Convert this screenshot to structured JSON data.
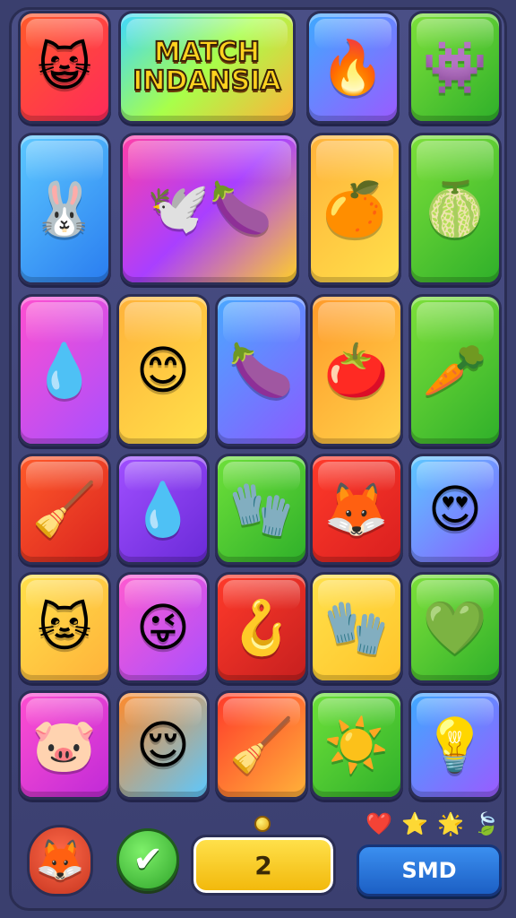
{
  "title": "MATCH\nINDANSIA",
  "tiles": [
    {
      "name": "blue-cat-coin-tile",
      "glyph": "😺",
      "bg": "linear-gradient(135deg,#ff5a2a,#ff2a5a)"
    },
    {
      "name": "fire-face-tile",
      "glyph": "🔥",
      "bg": "linear-gradient(135deg,#3fa9ff,#9a5bff)"
    },
    {
      "name": "green-blob-tile",
      "glyph": "👾",
      "bg": "linear-gradient(135deg,#7de03a,#2fb02a)"
    },
    {
      "name": "bunny-tile",
      "glyph": "🐰",
      "bg": "linear-gradient(135deg,#5cc8ff,#2a7df0)"
    },
    {
      "name": "dove-eggplant-tile",
      "glyph": "🕊️🍆",
      "bg": "linear-gradient(135deg,#ff3fa8,#a93fff,#ffcf2a)"
    },
    {
      "name": "orange-ball-tile",
      "glyph": "🍊",
      "bg": "linear-gradient(135deg,#ffb23a,#ffe04a)"
    },
    {
      "name": "green-drop-tile",
      "glyph": "🍈",
      "bg": "linear-gradient(135deg,#7de03a,#2fb02a)"
    },
    {
      "name": "blue-drop-tile",
      "glyph": "💧",
      "bg": "linear-gradient(135deg,#ff4fd0,#a84fff)"
    },
    {
      "name": "yellow-blob-tile",
      "glyph": "😊",
      "bg": "linear-gradient(135deg,#ffb23a,#ffe04a)"
    },
    {
      "name": "eggplant-tile",
      "glyph": "🍆",
      "bg": "linear-gradient(135deg,#4aa8ff,#8a5bff)"
    },
    {
      "name": "red-blob-tile",
      "glyph": "🍅",
      "bg": "linear-gradient(135deg,#ff9a2a,#ffd24a)"
    },
    {
      "name": "carrot-tile",
      "glyph": "🥕",
      "bg": "linear-gradient(135deg,#7de03a,#2fb02a)"
    },
    {
      "name": "broom-tile",
      "glyph": "🧹",
      "bg": "linear-gradient(135deg,#ff5a2a,#d9231f)"
    },
    {
      "name": "blue-drop-coin-tile",
      "glyph": "💧",
      "bg": "linear-gradient(135deg,#a04fff,#6a2ad8)"
    },
    {
      "name": "red-glove-tile",
      "glyph": "🧤",
      "bg": "linear-gradient(135deg,#6ee03a,#2fb02a)"
    },
    {
      "name": "yellow-fox-tile",
      "glyph": "🦊",
      "bg": "linear-gradient(135deg,#ff3a2a,#d91f1f)"
    },
    {
      "name": "heart-eyes-face-tile",
      "glyph": "😍",
      "bg": "linear-gradient(135deg,#5cc8ff,#8a5bff)"
    },
    {
      "name": "green-cat-tile",
      "glyph": "🐱",
      "bg": "linear-gradient(135deg,#ffe04a,#ffb23a)"
    },
    {
      "name": "winking-face-tile",
      "glyph": "😜",
      "bg": "linear-gradient(135deg,#ff5ad0,#a84fff)"
    },
    {
      "name": "red-hook-tile",
      "glyph": "🪝",
      "bg": "linear-gradient(135deg,#ff3a2a,#c61f1f)"
    },
    {
      "name": "red-glove-yellow-tile",
      "glyph": "🧤",
      "bg": "linear-gradient(135deg,#ffe04a,#ffc42a)"
    },
    {
      "name": "green-drop-smile-tile",
      "glyph": "💚",
      "bg": "linear-gradient(135deg,#7de03a,#2fb02a)"
    },
    {
      "name": "pink-blob-tile",
      "glyph": "🐷",
      "bg": "linear-gradient(135deg,#ff4fd0,#c02ad8)"
    },
    {
      "name": "blue-blob-tile",
      "glyph": "😌",
      "bg": "linear-gradient(135deg,#ff8a2a,#5cc8ff)"
    },
    {
      "name": "broom-red-tile",
      "glyph": "🧹",
      "bg": "linear-gradient(135deg,#ff3a2a,#ffb23a)"
    },
    {
      "name": "sun-tile",
      "glyph": "☀️",
      "bg": "linear-gradient(135deg,#6ee03a,#2fb02a)"
    },
    {
      "name": "bulb-creature-tile",
      "glyph": "💡",
      "bg": "linear-gradient(135deg,#3fa9ff,#9a5bff)"
    }
  ],
  "bottom": {
    "avatar_glyph": "🦊",
    "check_glyph": "✔",
    "score": "2",
    "smd_label": "SMD",
    "icons": [
      {
        "name": "heart-icon",
        "glyph": "❤️"
      },
      {
        "name": "star-white-icon",
        "glyph": "⭐"
      },
      {
        "name": "star-orange-icon",
        "glyph": "🌟"
      },
      {
        "name": "leaf-icon",
        "glyph": "🍃"
      }
    ]
  }
}
